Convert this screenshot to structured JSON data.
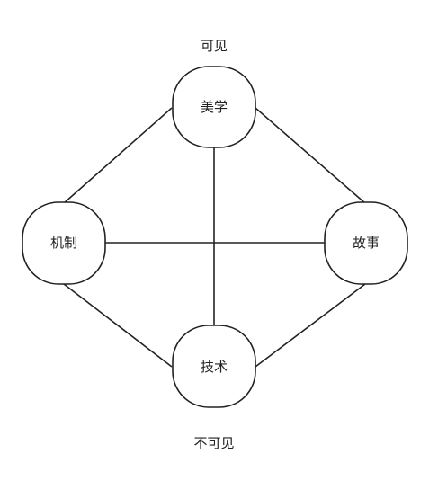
{
  "diagram": {
    "top_caption": "可见",
    "bottom_caption": "不可见",
    "nodes": {
      "aesthetics": "美学",
      "mechanics": "机制",
      "story": "故事",
      "technology": "技术"
    }
  }
}
